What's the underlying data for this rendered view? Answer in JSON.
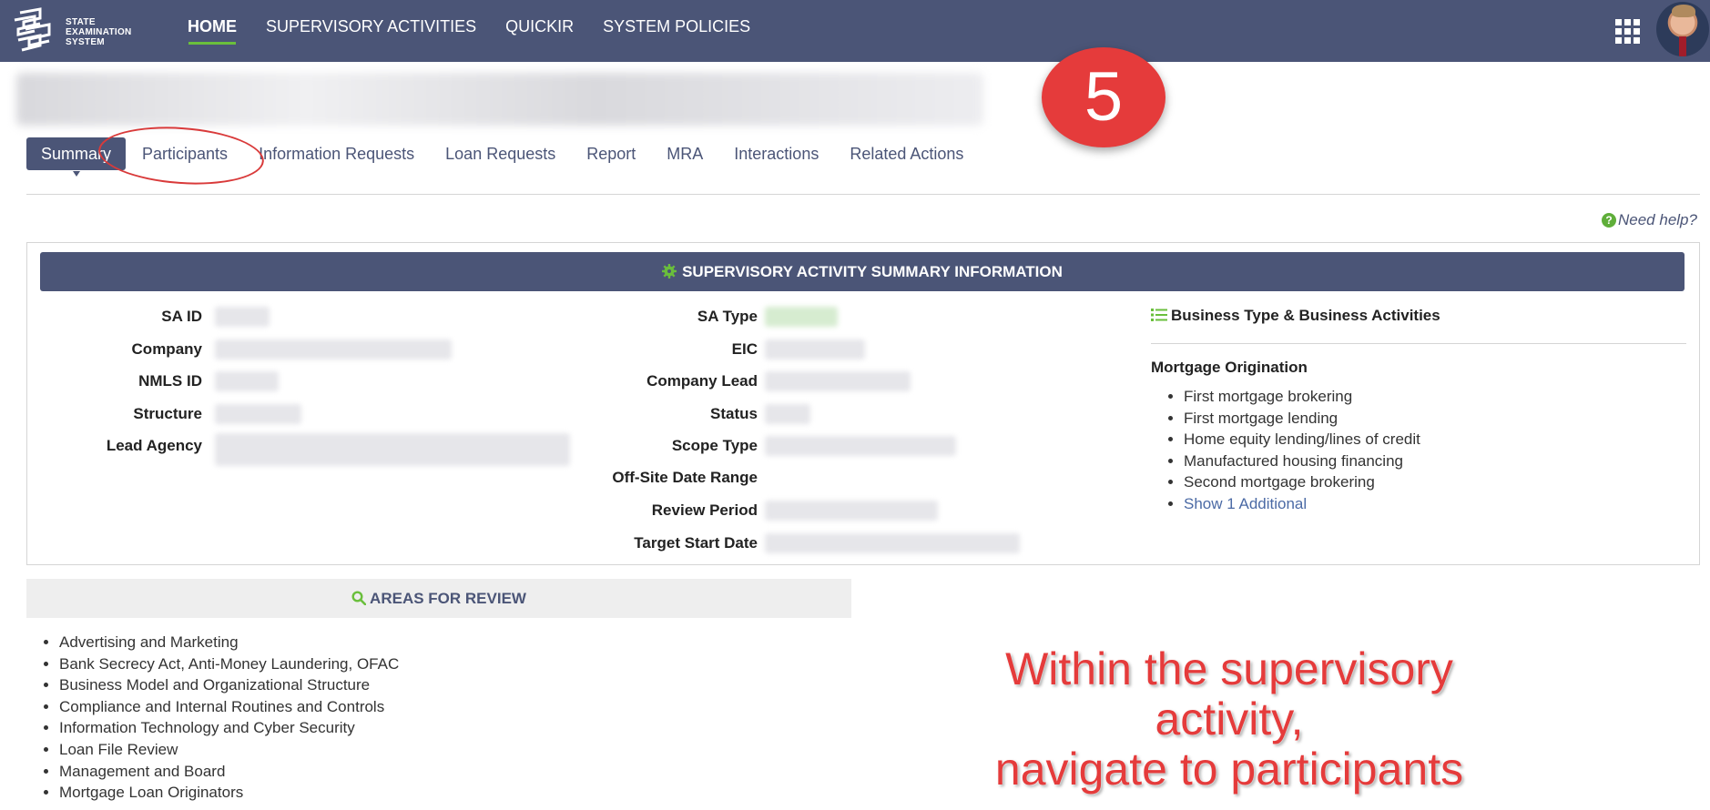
{
  "brand": {
    "name_lines": [
      "STATE",
      "EXAMINATION",
      "SYSTEM"
    ],
    "logo_icon": "ses-logo-icon",
    "nav_color": "#4b5577",
    "accent": "#6abf3c"
  },
  "nav": {
    "items": [
      {
        "label": "HOME",
        "active": true
      },
      {
        "label": "SUPERVISORY ACTIVITIES",
        "active": false
      },
      {
        "label": "QUICKIR",
        "active": false
      },
      {
        "label": "SYSTEM POLICIES",
        "active": false
      }
    ],
    "apps_icon": "apps-grid-icon",
    "avatar_icon": "user-avatar"
  },
  "step": {
    "number": "5"
  },
  "tabs": [
    {
      "label": "Summary",
      "active": true
    },
    {
      "label": "Participants",
      "active": false
    },
    {
      "label": "Information Requests",
      "active": false
    },
    {
      "label": "Loan Requests",
      "active": false
    },
    {
      "label": "Report",
      "active": false
    },
    {
      "label": "MRA",
      "active": false
    },
    {
      "label": "Interactions",
      "active": false
    },
    {
      "label": "Related Actions",
      "active": false
    }
  ],
  "help": {
    "label": "Need help?",
    "icon": "question-circle-icon"
  },
  "summary": {
    "header": "SUPERVISORY ACTIVITY SUMMARY INFORMATION",
    "header_icon": "gear-icon",
    "left_fields": [
      "SA ID",
      "Company",
      "NMLS ID",
      "Structure",
      "Lead Agency"
    ],
    "middle_fields": [
      "SA Type",
      "EIC",
      "Company Lead",
      "Status",
      "Scope Type",
      "Off-Site Date Range",
      "Review Period",
      "Target Start Date"
    ]
  },
  "business": {
    "title": "Business Type & Business Activities",
    "icon": "list-icon",
    "subtitle": "Mortgage Origination",
    "items": [
      "First mortgage brokering",
      "First mortgage lending",
      "Home equity lending/lines of credit",
      "Manufactured housing financing",
      "Second mortgage brokering"
    ],
    "show_more": "Show 1 Additional"
  },
  "areas": {
    "header": "AREAS FOR REVIEW",
    "icon": "search-icon",
    "items": [
      "Advertising and Marketing",
      "Bank Secrecy Act, Anti-Money Laundering, OFAC",
      "Business Model and Organizational Structure",
      "Compliance and Internal Routines and Controls",
      "Information Technology and Cyber Security",
      "Loan File Review",
      "Management and Board",
      "Mortgage Loan Originators"
    ]
  },
  "annotation": {
    "lines": [
      "Within the supervisory activity,",
      "navigate to participants"
    ],
    "color": "#e53b3b"
  }
}
